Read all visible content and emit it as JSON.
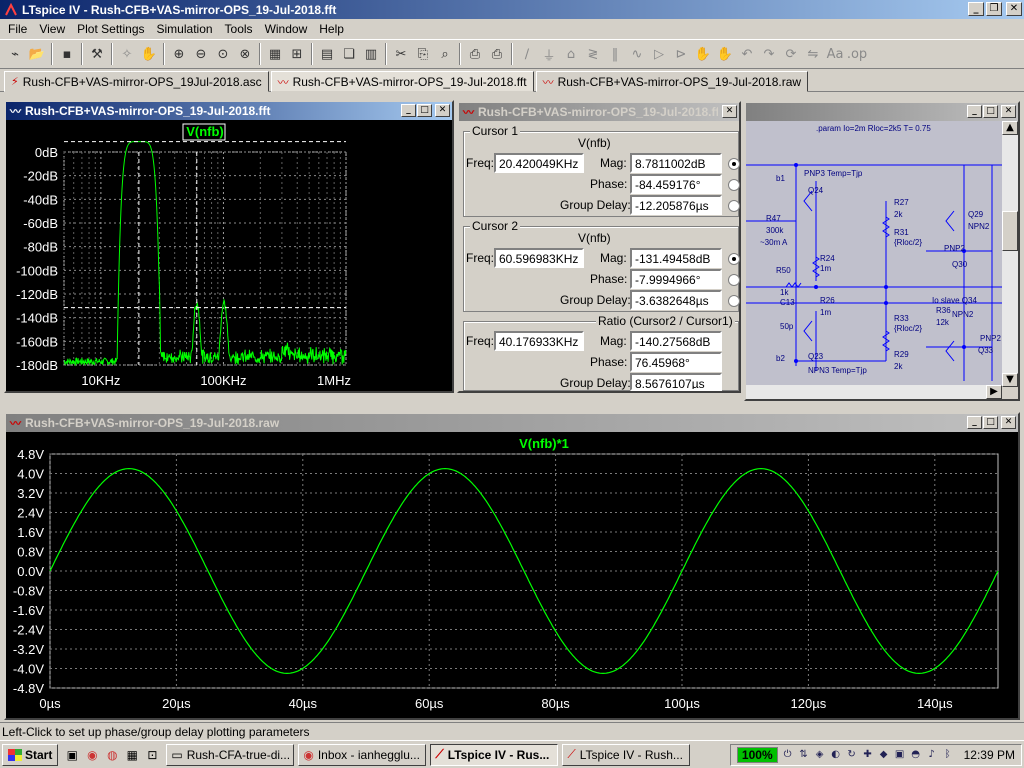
{
  "app": {
    "title": "LTspice IV - Rush-CFB+VAS-mirror-OPS_19-Jul-2018.fft"
  },
  "menu": [
    "File",
    "View",
    "Plot Settings",
    "Simulation",
    "Tools",
    "Window",
    "Help"
  ],
  "toolbar_icons": [
    "new-schematic-icon",
    "open-icon",
    "save-icon",
    "control-panel-icon",
    "run-icon",
    "halt-icon",
    "zoom-in-icon",
    "zoom-out-icon",
    "zoom-fit-icon",
    "zoom-cancel-icon",
    "autorange-icon",
    "grid-icon",
    "tile-horizontal-icon",
    "cascade-icon",
    "tile-vertical-icon",
    "cut-icon",
    "copy-icon",
    "find-icon",
    "print-preview-icon",
    "print-icon",
    "wire-icon",
    "ground-icon",
    "label-icon",
    "resistor-icon",
    "capacitor-icon",
    "inductor-icon",
    "diode-icon",
    "component-icon",
    "move-icon",
    "drag-icon",
    "undo-icon",
    "redo-icon",
    "rotate-icon",
    "mirror-icon",
    "text-icon",
    "spice-directive-icon"
  ],
  "tabs": [
    {
      "label": "Rush-CFB+VAS-mirror-OPS_19Jul-2018.asc",
      "icon": "schematic-icon"
    },
    {
      "label": "Rush-CFB+VAS-mirror-OPS_19-Jul-2018.fft",
      "icon": "waveform-icon"
    },
    {
      "label": "Rush-CFB+VAS-mirror-OPS_19-Jul-2018.raw",
      "icon": "waveform-icon"
    }
  ],
  "fft_window": {
    "title": "Rush-CFB+VAS-mirror-OPS_19-Jul-2018.fft",
    "trace": "V(nfb)",
    "chart_data": {
      "type": "line",
      "x_scale": "log",
      "xlim": [
        5000,
        1000000
      ],
      "ylim": [
        -180,
        0
      ],
      "x_ticks": [
        "10KHz",
        "100KHz",
        "1MHz"
      ],
      "y_ticks": [
        "0dB",
        "-20dB",
        "-40dB",
        "-60dB",
        "-80dB",
        "-100dB",
        "-120dB",
        "-140dB",
        "-160dB",
        "-180dB"
      ],
      "series": [
        {
          "name": "V(nfb)",
          "color": "#00ff00"
        }
      ],
      "cursor1": {
        "freq_hz": 20420,
        "mag_db": 8.78
      },
      "cursor2": {
        "freq_hz": 60597,
        "mag_db": -131.49
      }
    }
  },
  "cursor_window": {
    "title": "Rush-CFB+VAS-mirror-OPS_19-Jul-2018.fft",
    "cursor1": {
      "label": "Cursor 1",
      "trace": "V(nfb)",
      "freq_label": "Freq:",
      "freq": "20.420049KHz",
      "mag_label": "Mag:",
      "mag": "8.7811002dB",
      "phase_label": "Phase:",
      "phase": "-84.459176°",
      "gd_label": "Group Delay:",
      "gd": "-12.205876µs"
    },
    "cursor2": {
      "label": "Cursor 2",
      "trace": "V(nfb)",
      "freq_label": "Freq:",
      "freq": "60.596983KHz",
      "mag_label": "Mag:",
      "mag": "-131.49458dB",
      "phase_label": "Phase:",
      "phase": "-7.9994966°",
      "gd_label": "Group Delay:",
      "gd": "-3.6382648µs"
    },
    "ratio": {
      "label": "Ratio (Cursor2 / Cursor1)",
      "freq_label": "Freq:",
      "freq": "40.176933KHz",
      "mag_label": "Mag:",
      "mag": "-140.27568dB",
      "phase_label": "Phase:",
      "phase": "76.45968°",
      "gd_label": "Group Delay:",
      "gd": "8.5676107µs"
    }
  },
  "schematic": {
    "directive": ".param Io=2m  Rloc=2k5  T= 0.75",
    "labels": [
      "b1",
      "PNP3 Temp=Tjp",
      "Q24",
      "R47",
      "300k",
      "~30m A",
      "R50",
      "1k",
      "C13",
      "50p",
      "R24",
      "1m",
      "R26",
      "1m",
      "R27",
      "2k",
      "R31",
      "{Rloc/2}",
      "R33",
      "{Rloc/2}",
      "R29",
      "2k",
      "Q29",
      "NPN2",
      "PNP2",
      "Q30",
      "R36",
      "12k",
      "Io slave Q34",
      "NPN2",
      "PNP2",
      "Q33",
      "b2",
      "Q23",
      "NPN3 Temp=Tjp"
    ]
  },
  "raw_window": {
    "title": "Rush-CFB+VAS-mirror-OPS_19-Jul-2018.raw",
    "trace": "V(nfb)*1",
    "chart_data": {
      "type": "line",
      "xlim": [
        0,
        150
      ],
      "ylim": [
        -4.8,
        4.8
      ],
      "x_unit": "µs",
      "x_ticks": [
        "0µs",
        "20µs",
        "40µs",
        "60µs",
        "80µs",
        "100µs",
        "120µs",
        "140µs"
      ],
      "y_ticks": [
        "4.8V",
        "4.0V",
        "3.2V",
        "2.4V",
        "1.6V",
        "0.8V",
        "0.0V",
        "-0.8V",
        "-1.6V",
        "-2.4V",
        "-3.2V",
        "-4.0V",
        "-4.8V"
      ],
      "series": [
        {
          "name": "V(nfb)*1",
          "color": "#00ff00",
          "amplitude": 4.2,
          "period_us": 50
        }
      ]
    }
  },
  "status": "Left-Click to set up phase/group delay plotting parameters",
  "taskbar": {
    "start": "Start",
    "tasks": [
      {
        "label": "Rush-CFA-true-di...",
        "active": false
      },
      {
        "label": "Inbox - ianhegglu...",
        "active": false
      },
      {
        "label": "LTspice IV - Rus...",
        "active": true
      },
      {
        "label": "LTspice IV - Rush...",
        "active": false
      }
    ],
    "zoom": "100%",
    "clock": "12:39 PM"
  }
}
